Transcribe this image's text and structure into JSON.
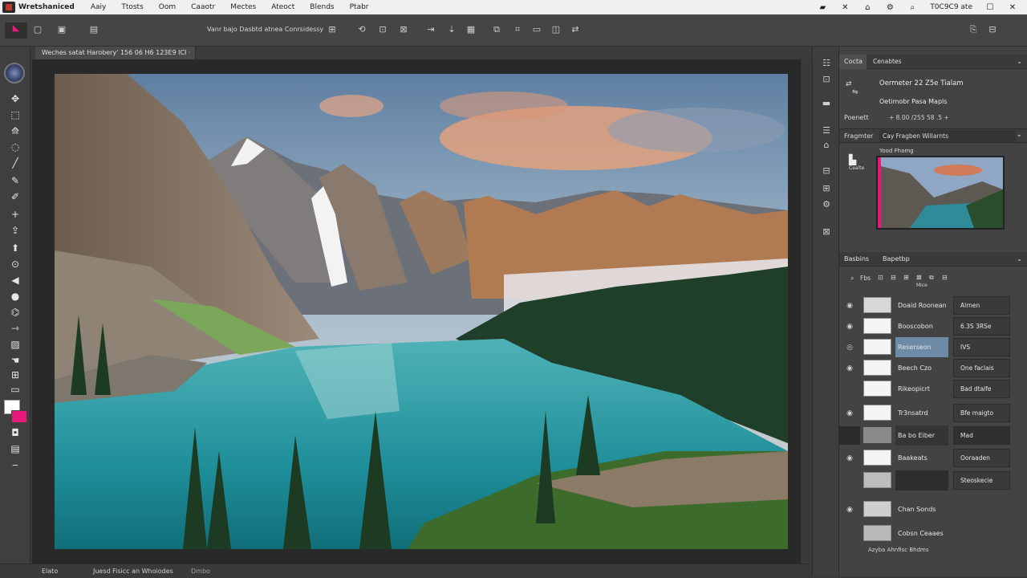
{
  "menubar": {
    "app_name": "Wretshaniced",
    "items": [
      "Aaiy",
      "Ttosts",
      "Oom",
      "Caaotr",
      "Mectes",
      "Ateoct",
      "Blends",
      "Ptabr"
    ],
    "right_text": "T0C9C9 ate"
  },
  "toolbar": {
    "options_text": "Vanr bajo Dasbtd atnea Conrsidessy"
  },
  "document": {
    "tab_title": "Weches satat Harobery' 156 06 H6 123E9 ICI ·"
  },
  "colors": {
    "accent": "#e8187c",
    "selection": "#6d8aa6"
  },
  "panels": {
    "top": {
      "tab1": "Cocta",
      "tab2": "Cenabtes",
      "line1": "Oermeter 22 Z5e Tialam",
      "line2": "Oetimobr Pasa Mapls",
      "row_label": "Poenett",
      "row_value": "+ 8.00 /255 58 .5 +",
      "frag_label": "Fragmter",
      "frag_value": "Cay Fragben Willarnts",
      "preview_label": "Yood Fhamg",
      "side_icon_label": "Cealte"
    },
    "layers": {
      "tab1": "Basbins",
      "tab2": "Bapetbp",
      "bar_label": "Fbs",
      "center_label": "Mice",
      "rows": [
        {
          "name": "Doaid Roonean",
          "right": "Alrnen"
        },
        {
          "name": "Booscobon",
          "right": "6.3S 3RSe"
        },
        {
          "name": "Reserseon",
          "right": "IVS"
        },
        {
          "name": "Beech Czo",
          "right": "One faclais"
        },
        {
          "name": "Rikeopicrt",
          "right": "Bad dtalfe"
        },
        {
          "name": "Tr3nsatrd",
          "right": "Bfe maigto"
        },
        {
          "name": "Ba bo Eiber",
          "right": "Mad"
        },
        {
          "name": "Baakeats",
          "right": "Ooraaden"
        },
        {
          "name": "",
          "right": "Steoskecie"
        },
        {
          "name": "Chan Sonds",
          "right": ""
        },
        {
          "name": "Cobsn Ceaaes",
          "right": ""
        }
      ],
      "footer": "Azyba Ahnfisc Bhdms"
    }
  },
  "status": {
    "left": "Elato",
    "mid": "Juesd Fisicc an Whoiodes",
    "right": "Dmbo"
  }
}
